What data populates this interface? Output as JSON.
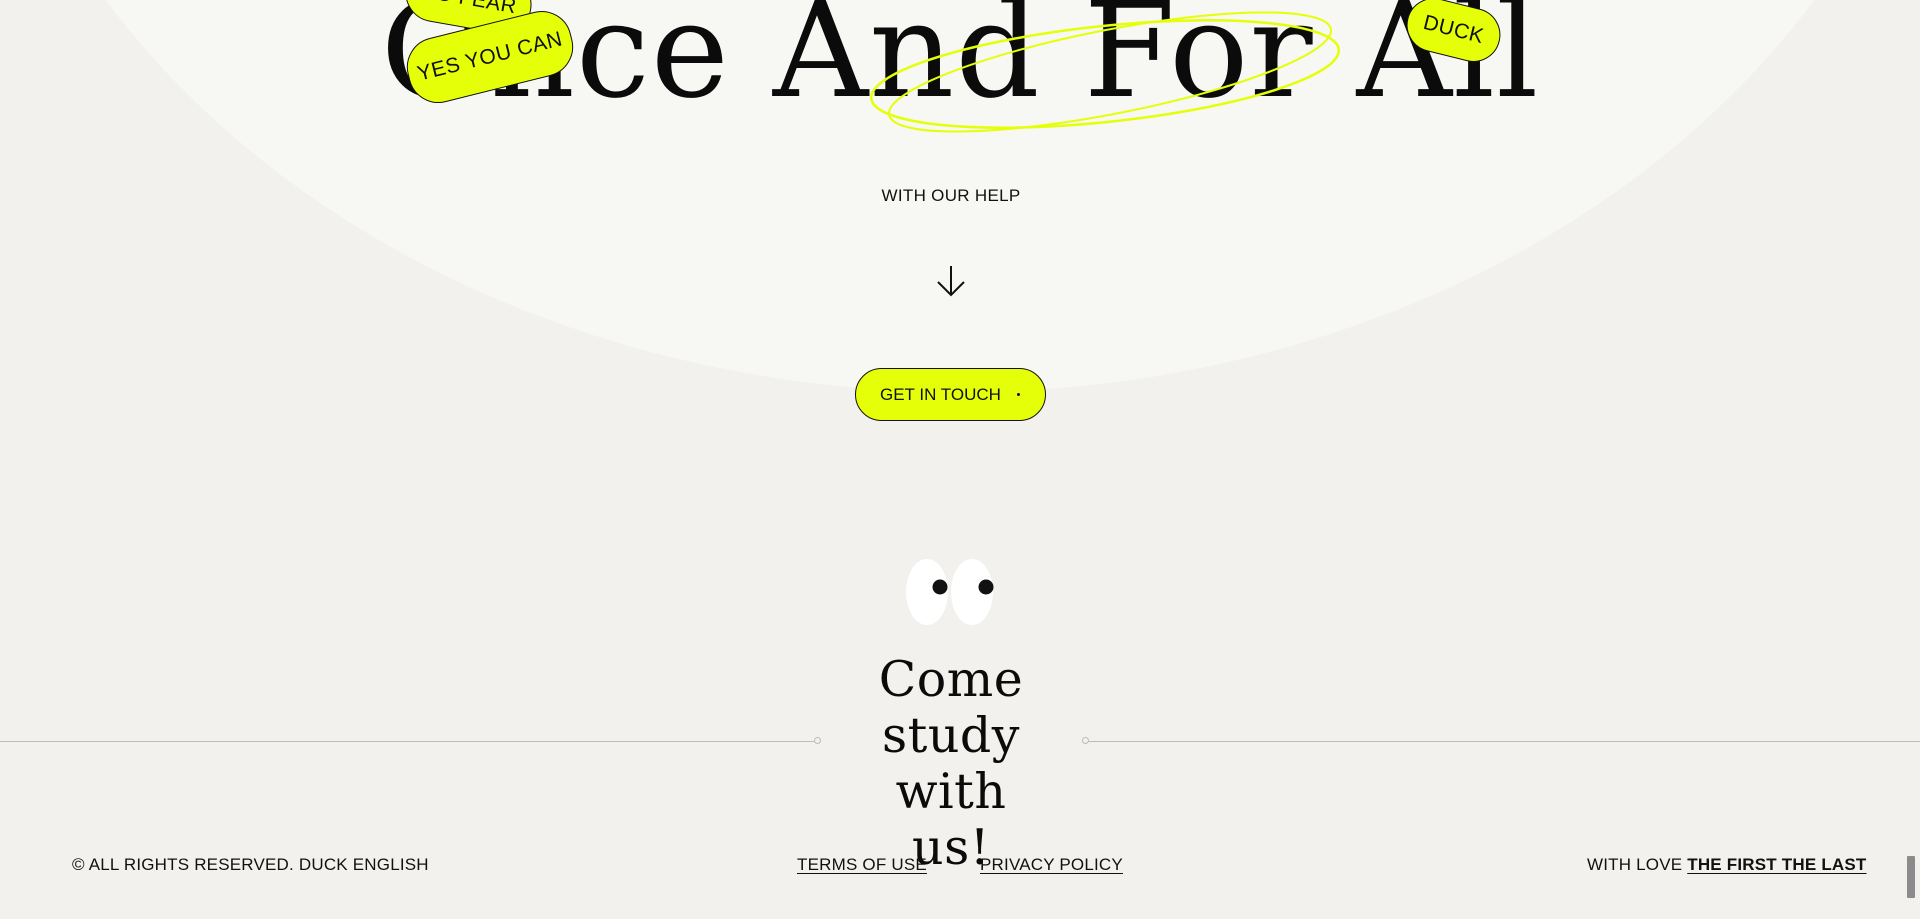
{
  "hero": {
    "title": "Once And For All",
    "subtitle": "WITH OUR HELP",
    "stickers": {
      "no_fear": "NO FEAR",
      "yes_you_can": "YES YOU CAN",
      "duck": "DUCK"
    },
    "arrow_icon": "arrow-down-icon"
  },
  "cta": {
    "button_label": "GET IN TOUCH",
    "heading": "Come study with us!",
    "eyes_icon": "eyes-icon"
  },
  "footer": {
    "copyright": "© ALL RIGHTS RESERVED. DUCK ENGLISH",
    "terms": "TERMS OF USE",
    "privacy": "PRIVACY POLICY",
    "credit_prefix": "WITH LOVE",
    "credit_link": "THE FIRST THE LAST"
  },
  "colors": {
    "accent": "#e4ff08",
    "background": "#f2f1ed",
    "arc": "#f7f7f3",
    "text": "#111111"
  }
}
